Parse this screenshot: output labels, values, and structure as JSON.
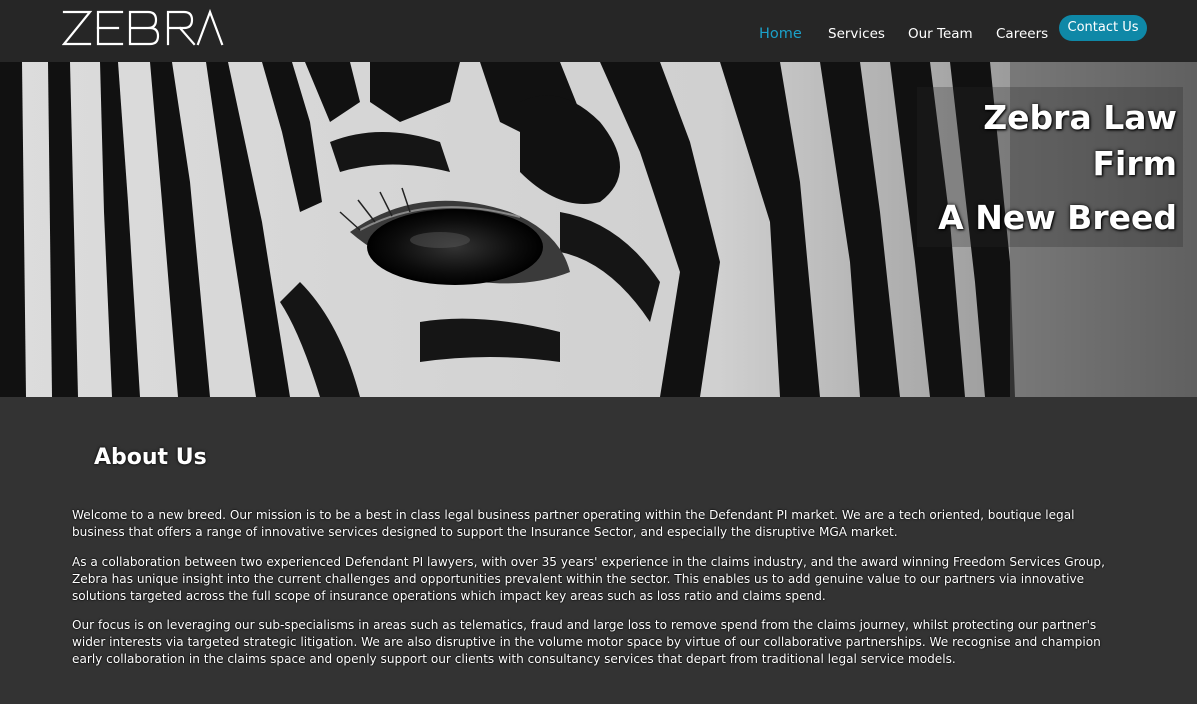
{
  "brand": {
    "logo_text": "ZEBRA"
  },
  "nav": {
    "items": [
      {
        "label": "Home",
        "active": true
      },
      {
        "label": "Services"
      },
      {
        "label": "Our Team"
      },
      {
        "label": "Careers"
      }
    ],
    "contact_label": "Contact Us"
  },
  "colors": {
    "nav_background": "#262626",
    "accent": "#1ba0c9",
    "contact_button": "#0f88a7",
    "page_background": "#333333"
  },
  "hero": {
    "line1": "Zebra Law",
    "line2": "Firm",
    "line3": "A New Breed"
  },
  "about": {
    "title": "About Us",
    "paragraphs": [
      "Welcome to a new breed. Our mission is to be a best in class legal business partner operating within the Defendant PI market. We are a tech oriented, boutique legal business that offers a range of innovative services designed to support the Insurance Sector, and especially the disruptive MGA market.",
      "As a collaboration between two experienced Defendant PI lawyers, with over 35 years' experience in the claims industry, and the award winning Freedom Services Group, Zebra has unique insight into the current challenges and opportunities prevalent within the sector. This enables us to add genuine value to our partners via innovative solutions targeted across the full scope of insurance operations which impact key areas such as loss ratio and claims spend.",
      "Our focus is on leveraging our sub-specialisms in areas such as telematics, fraud and large loss to remove spend from the claims journey, whilst protecting our partner's wider interests via targeted strategic litigation. We are also disruptive in the volume motor space by virtue of our collaborative partnerships. We recognise and champion early collaboration in the claims space and openly support our clients with consultancy services that depart from traditional legal service models."
    ]
  }
}
